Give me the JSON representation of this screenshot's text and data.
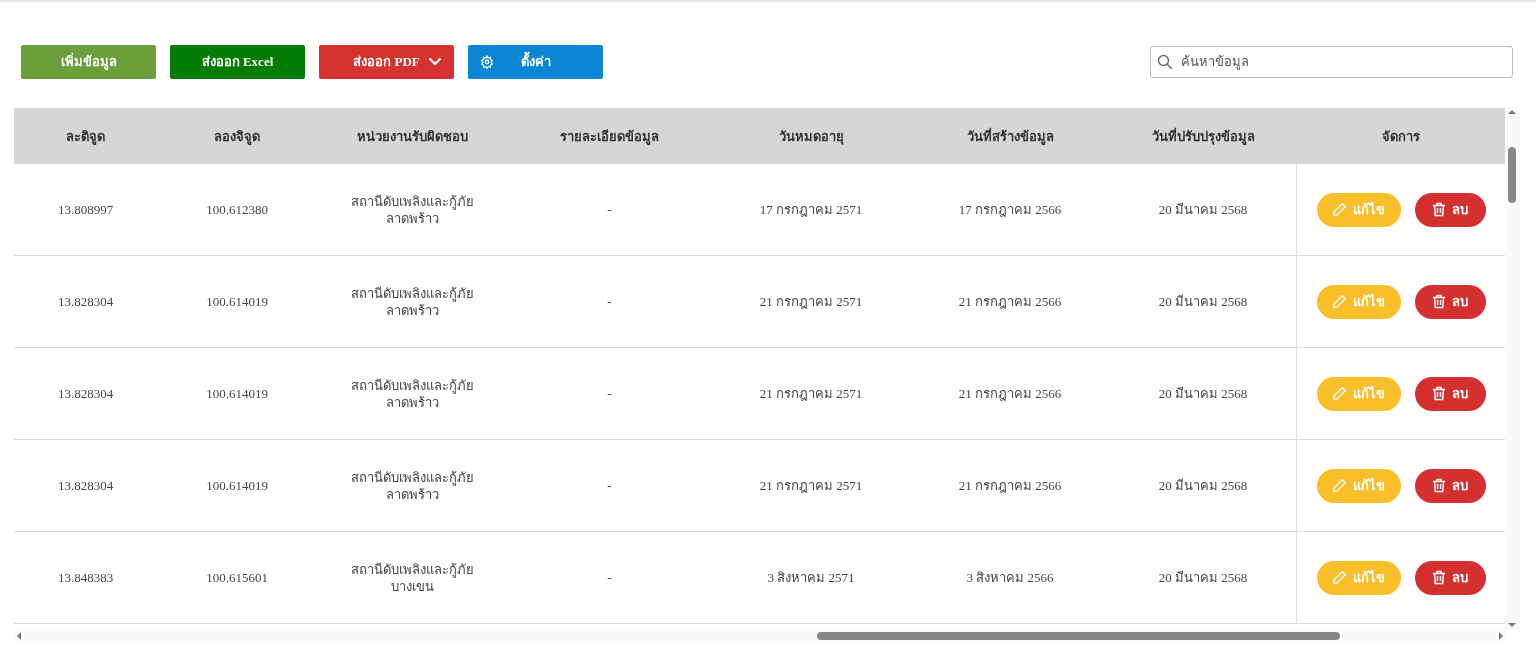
{
  "toolbar": {
    "buttons": [
      {
        "kind": "add",
        "label": "เพิ่มข้อมูล"
      },
      {
        "kind": "excel",
        "label": "ส่งออก Excel"
      },
      {
        "kind": "pdf",
        "label": "ส่งออก PDF"
      },
      {
        "kind": "settings",
        "label": "ตั้งค่า"
      }
    ],
    "search": {
      "placeholder": "ค้นหาข้อมูล"
    }
  },
  "table": {
    "columns": [
      "ละติจูด",
      "ลองจิจูด",
      "หน่วยงานรับผิดชอบ",
      "รายละเอียดข้อมูล",
      "วันหมดอายุ",
      "วันที่สร้างข้อมูล",
      "วันที่ปรับปรุงข้อมูล",
      "จัดการ"
    ],
    "rows": [
      {
        "cells": [
          "13.808997",
          "100.612380",
          "สถานีดับเพลิงและกู้ภัย\nลาดพร้าว",
          "-",
          "17 กรกฎาคม 2571",
          "17 กรกฎาคม 2566",
          "20 มีนาคม 2568"
        ],
        "actions": [
          {
            "kind": "edit",
            "label": "แก้ไข"
          },
          {
            "kind": "delete",
            "label": "ลบ"
          }
        ]
      },
      {
        "cells": [
          "13.828304",
          "100.614019",
          "สถานีดับเพลิงและกู้ภัย\nลาดพร้าว",
          "-",
          "21 กรกฎาคม 2571",
          "21 กรกฎาคม 2566",
          "20 มีนาคม 2568"
        ],
        "actions": [
          {
            "kind": "edit",
            "label": "แก้ไข"
          },
          {
            "kind": "delete",
            "label": "ลบ"
          }
        ]
      },
      {
        "cells": [
          "13.828304",
          "100.614019",
          "สถานีดับเพลิงและกู้ภัย\nลาดพร้าว",
          "-",
          "21 กรกฎาคม 2571",
          "21 กรกฎาคม 2566",
          "20 มีนาคม 2568"
        ],
        "actions": [
          {
            "kind": "edit",
            "label": "แก้ไข"
          },
          {
            "kind": "delete",
            "label": "ลบ"
          }
        ]
      },
      {
        "cells": [
          "13.828304",
          "100.614019",
          "สถานีดับเพลิงและกู้ภัย\nลาดพร้าว",
          "-",
          "21 กรกฎาคม 2571",
          "21 กรกฎาคม 2566",
          "20 มีนาคม 2568"
        ],
        "actions": [
          {
            "kind": "edit",
            "label": "แก้ไข"
          },
          {
            "kind": "delete",
            "label": "ลบ"
          }
        ]
      },
      {
        "cells": [
          "13.848383",
          "100.615601",
          "สถานีดับเพลิงและกู้ภัย\nบางเขน",
          "-",
          "3 สิงหาคม 2571",
          "3 สิงหาคม 2566",
          "20 มีนาคม 2568"
        ],
        "actions": [
          {
            "kind": "edit",
            "label": "แก้ไข"
          },
          {
            "kind": "delete",
            "label": "ลบ"
          }
        ]
      }
    ]
  }
}
